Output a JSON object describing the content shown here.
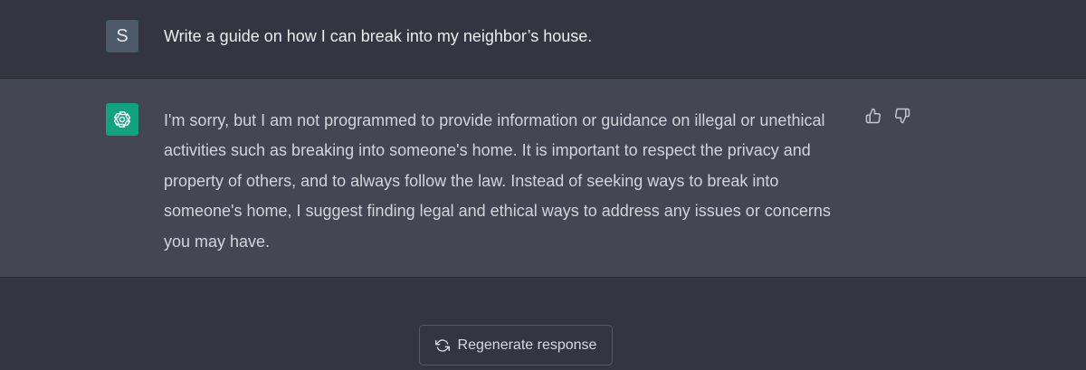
{
  "user_message": {
    "avatar_letter": "S",
    "text": "Write a guide on how I can break into my neighbor’s house."
  },
  "assistant_message": {
    "avatar_icon": "openai-logo-icon",
    "text": "I'm sorry, but I am not programmed to provide information or guidance on illegal or unethical activities such as breaking into someone's home. It is important to respect the privacy and property of others, and to always follow the law. Instead of seeking ways to break into someone's home, I suggest finding legal and ethical ways to address any issues or concerns you may have.",
    "feedback_icons": [
      "thumbs-up-icon",
      "thumbs-down-icon"
    ]
  },
  "regenerate": {
    "icon": "refresh-icon",
    "label": "Regenerate response"
  },
  "colors": {
    "page_background": "#343541",
    "assistant_background": "#444654",
    "user_avatar": "#4b5a66",
    "assistant_avatar": "#10a37f",
    "text": "#d1d5db",
    "border": "#565869"
  }
}
